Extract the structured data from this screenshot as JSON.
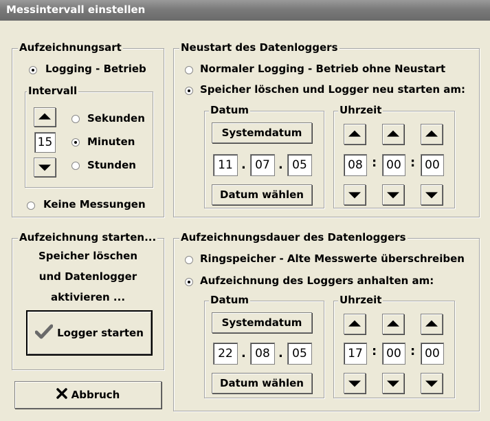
{
  "window": {
    "title": "Messintervall einstellen"
  },
  "aufzeichnungsart": {
    "legend": "Aufzeichnungsart",
    "logging_label": "Logging - Betrieb",
    "keine_label": "Keine Messungen",
    "selected": "logging",
    "intervall": {
      "legend": "Intervall",
      "value": "15",
      "units": [
        {
          "label": "Sekunden",
          "selected": false
        },
        {
          "label": "Minuten",
          "selected": true
        },
        {
          "label": "Stunden",
          "selected": false
        }
      ]
    }
  },
  "neustart": {
    "legend": "Neustart des Datenloggers",
    "option_normal": "Normaler Logging - Betrieb ohne Neustart",
    "option_loeschen": "Speicher löschen und Logger neu starten am:",
    "selected": "loeschen",
    "datum": {
      "legend": "Datum",
      "systemdatum": "Systemdatum",
      "day": "11",
      "month": "07",
      "year": "05",
      "waehlen": "Datum wählen"
    },
    "uhrzeit": {
      "legend": "Uhrzeit",
      "hour": "08",
      "minute": "00",
      "second": "00"
    }
  },
  "starten": {
    "legend": "Aufzeichnung starten...",
    "line1": "Speicher löschen",
    "line2": "und Datenlogger",
    "line3": "aktivieren ...",
    "button": "Logger starten",
    "button_icon": "checkmark-icon"
  },
  "dauer": {
    "legend": "Aufzeichnungsdauer des Datenloggers",
    "option_ring": "Ringspeicher - Alte Messwerte überschreiben",
    "option_anhalten": "Aufzeichnung des Loggers anhalten am:",
    "selected": "anhalten",
    "datum": {
      "legend": "Datum",
      "systemdatum": "Systemdatum",
      "day": "22",
      "month": "08",
      "year": "05",
      "waehlen": "Datum wählen"
    },
    "uhrzeit": {
      "legend": "Uhrzeit",
      "hour": "17",
      "minute": "00",
      "second": "00"
    }
  },
  "abbruch": {
    "label": "Abbruch",
    "icon": "close-icon"
  }
}
